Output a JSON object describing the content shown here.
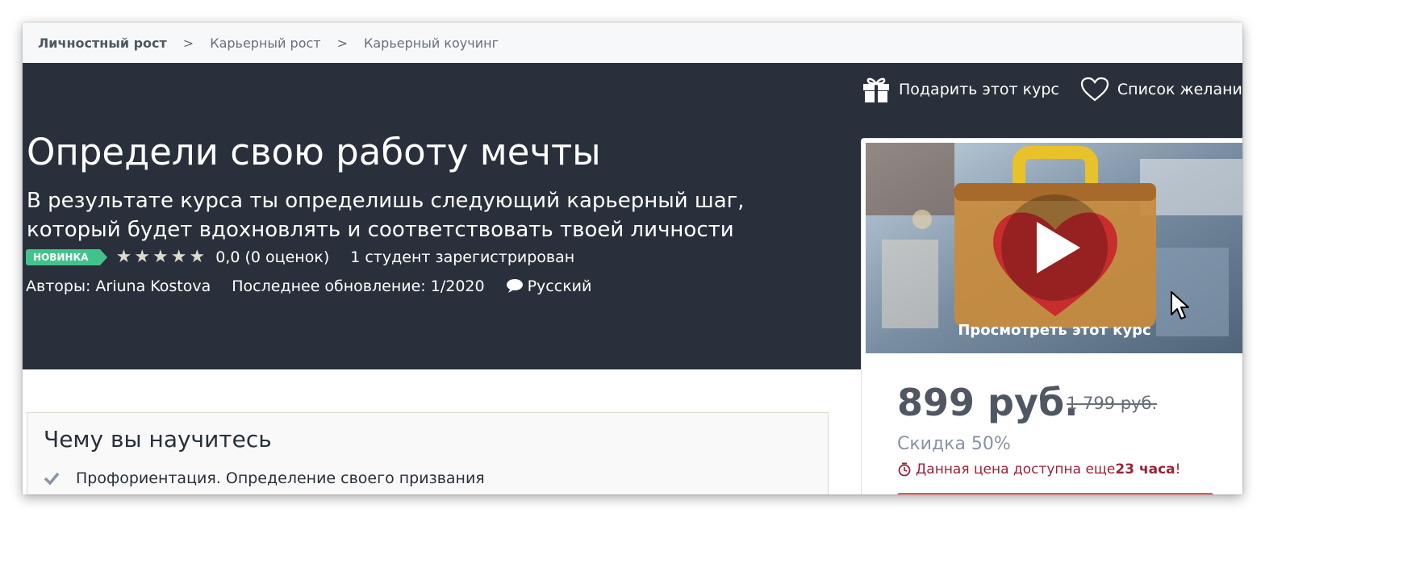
{
  "breadcrumb": {
    "items": [
      "Личностный рост",
      "Карьерный рост",
      "Карьерный коучинг"
    ],
    "separator": ">"
  },
  "actions": {
    "gift_label": "Подарить этот курс",
    "wishlist_label": "Список желаний"
  },
  "course": {
    "title": "Определи свою работу мечты",
    "subtitle": "В результате курса ты определишь следующий карьерный шаг, который будет вдохновлять и соответствовать твоей личности",
    "badge": "НОВИНКА",
    "rating": 0,
    "rating_text": "0,0 (0 оценок)",
    "students": "1 студент зарегистрирован",
    "authors": "Авторы: Ariuna Kostova",
    "updated": "Последнее обновление: 1/2020",
    "language": "Русский"
  },
  "sidebar": {
    "preview_label": "Просмотреть этот курс",
    "price": "899 руб.",
    "old_price": "1 799 руб.",
    "discount": "Скидка 50%",
    "timer_prefix": "Данная цена доступна еще ",
    "timer_bold": "23 часа",
    "timer_suffix": "!"
  },
  "learn": {
    "title": "Чему вы научитесь",
    "items": [
      "Профориентация. Определение своего призвания"
    ]
  },
  "colors": {
    "hero_bg": "#29303b",
    "badge": "#43c38c",
    "timer": "#992337",
    "buy": "#ec5252"
  }
}
